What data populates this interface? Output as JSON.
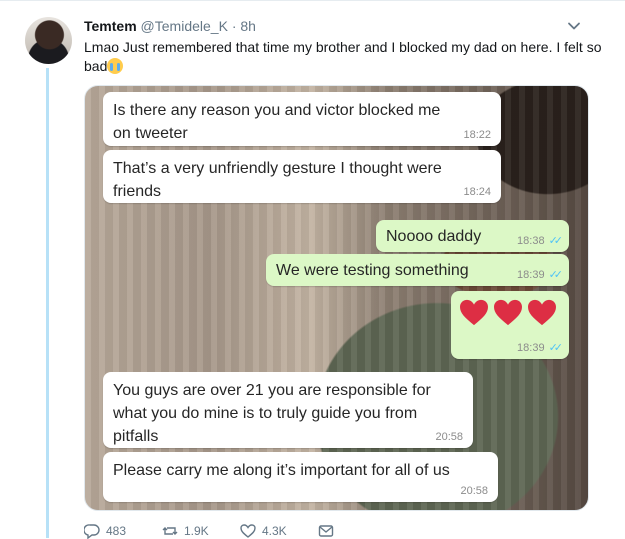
{
  "tweet": {
    "author_name": "Temtem",
    "author_handle": "@Temidele_K",
    "separator": "·",
    "time": "8h",
    "text": "Lmao Just remembered that time my brother and I blocked my dad on here. I felt so bad",
    "emoji": "loudly-crying-face"
  },
  "chat": {
    "messages": [
      {
        "from": "in",
        "text": [
          "Is there any reason you and victor blocked me",
          "on tweeter"
        ],
        "time": "18:22"
      },
      {
        "from": "in",
        "text": [
          "That’s a very unfriendly gesture I thought were",
          "friends"
        ],
        "time": "18:24"
      },
      {
        "from": "out",
        "text": [
          "Noooo daddy"
        ],
        "time": "18:38"
      },
      {
        "from": "out",
        "text": [
          "We were testing something"
        ],
        "time": "18:39"
      },
      {
        "from": "out",
        "content": "three-red-hearts",
        "time": "18:39"
      },
      {
        "from": "in",
        "text": [
          "You guys are over 21 you are responsible for",
          "what you do mine is to truly guide you from",
          "pitfalls"
        ],
        "time": "20:58"
      },
      {
        "from": "in",
        "text": [
          "Please carry me along it’s important for all of us"
        ],
        "time": "20:58"
      }
    ]
  },
  "actions": {
    "replies": "483",
    "retweets": "1.9K",
    "likes": "4.3K"
  },
  "colors": {
    "incoming_bubble": "#ffffff",
    "outgoing_bubble": "#dcf8c6",
    "read_ticks": "#4fc3f7",
    "thread_line": "#b7e1f7"
  }
}
